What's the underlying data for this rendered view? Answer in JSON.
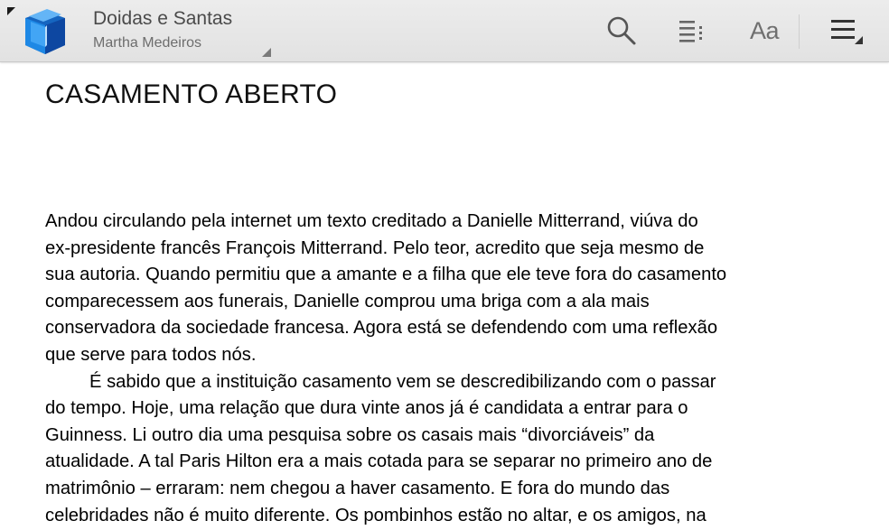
{
  "topbar": {
    "book_title": "Doidas e Santas",
    "author": "Martha Medeiros",
    "font_button_label": "Aa",
    "icons": {
      "app": "play-books-icon",
      "search": "search-icon",
      "contents": "table-of-contents-icon",
      "menu": "overflow-menu-icon"
    }
  },
  "content": {
    "chapter_title": "CASAMENTO ABERTO",
    "paragraphs": [
      [
        "Andou circulando pela internet um texto creditado a Danielle Mitterrand, viúva do",
        "ex-presidente francês François Mitterrand. Pelo teor, acredito que seja mesmo de",
        "sua autoria. Quando permitiu que a amante e a filha que ele teve fora do casamento",
        "comparecessem aos funerais, Danielle comprou uma briga com a ala mais",
        "conservadora da sociedade francesa. Agora está se defendendo com uma reflexão",
        "que serve para todos nós."
      ],
      [
        "É sabido que a instituição casamento vem se descredibilizando com o passar",
        "do tempo. Hoje, uma relação que dura vinte anos já é candidata a entrar para o",
        "Guinness. Li outro dia uma pesquisa sobre os casais mais “divorciáveis” da",
        "atualidade. A tal Paris Hilton era a mais cotada para se separar no primeiro ano de",
        "matrimônio – erraram: nem chegou a haver casamento. E fora do mundo das",
        "celebridades não é muito diferente. Os pombinhos estão no altar, e os amigos, na"
      ]
    ]
  },
  "colors": {
    "toolbar_bg": "#e6e6e6",
    "icon_gray": "#5a5a5a",
    "app_icon_blue": "#1e88e5",
    "text": "#000000"
  }
}
